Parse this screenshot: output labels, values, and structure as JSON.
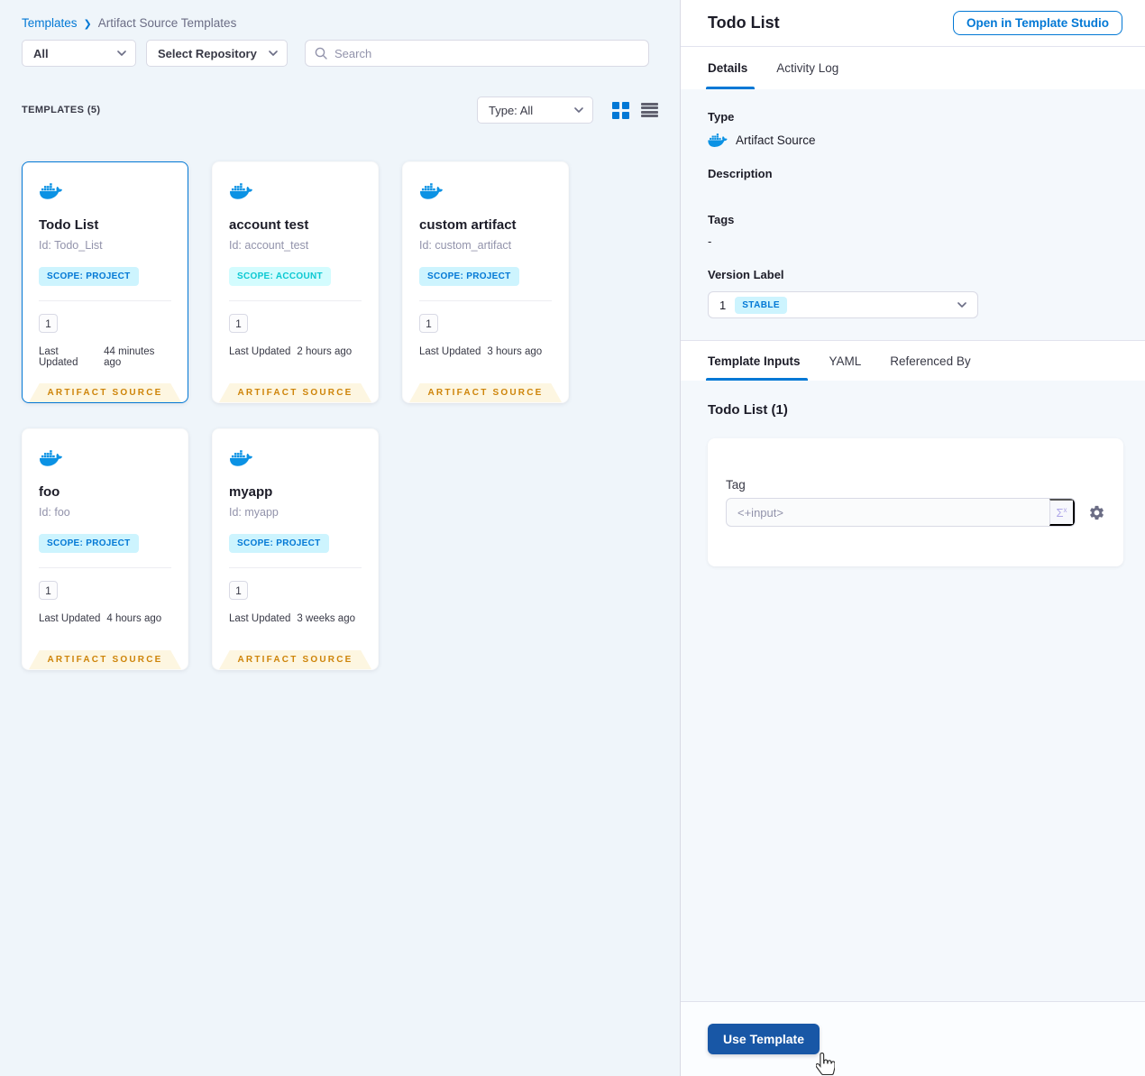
{
  "breadcrumb": {
    "root": "Templates",
    "separator": "❯",
    "current": "Artifact Source Templates"
  },
  "filters": {
    "scope_dropdown": "All",
    "repository_dropdown": "Select Repository",
    "search_placeholder": "Search"
  },
  "list_header": {
    "count_label": "TEMPLATES (5)",
    "type_filter_label": "Type: All"
  },
  "card_labels": {
    "last_updated": "Last Updated"
  },
  "cards": [
    {
      "title": "Todo List",
      "id": "Id: Todo_List",
      "scope": "SCOPE: PROJECT",
      "scope_type": "project",
      "version_count": "1",
      "updated": "44 minutes ago",
      "ribbon": "ARTIFACT SOURCE",
      "selected": true
    },
    {
      "title": "account test",
      "id": "Id: account_test",
      "scope": "SCOPE: ACCOUNT",
      "scope_type": "account",
      "version_count": "1",
      "updated": "2 hours ago",
      "ribbon": "ARTIFACT SOURCE",
      "selected": false
    },
    {
      "title": "custom artifact",
      "id": "Id: custom_artifact",
      "scope": "SCOPE: PROJECT",
      "scope_type": "project",
      "version_count": "1",
      "updated": "3 hours ago",
      "ribbon": "ARTIFACT SOURCE",
      "selected": false
    },
    {
      "title": "foo",
      "id": "Id: foo",
      "scope": "SCOPE: PROJECT",
      "scope_type": "project",
      "version_count": "1",
      "updated": "4 hours ago",
      "ribbon": "ARTIFACT SOURCE",
      "selected": false
    },
    {
      "title": "myapp",
      "id": "Id: myapp",
      "scope": "SCOPE: PROJECT",
      "scope_type": "project",
      "version_count": "1",
      "updated": "3 weeks ago",
      "ribbon": "ARTIFACT SOURCE",
      "selected": false
    }
  ],
  "panel": {
    "title": "Todo List",
    "open_in_studio_button": "Open in Template Studio",
    "tabs": {
      "details": "Details",
      "activity_log": "Activity Log"
    },
    "details": {
      "type_label": "Type",
      "type_value": "Artifact Source",
      "description_label": "Description",
      "tags_label": "Tags",
      "tags_value": "-",
      "version_label": "Version Label",
      "version_value": "1",
      "version_badge": "STABLE"
    },
    "inner_tabs": {
      "template_inputs": "Template Inputs",
      "yaml": "YAML",
      "referenced_by": "Referenced By"
    },
    "inputs": {
      "section_title": "Todo List (1)",
      "tag_label": "Tag",
      "tag_value": "<+input>",
      "expression_button": "Σ"
    },
    "footer": {
      "use_template_button": "Use Template"
    }
  },
  "colors": {
    "accent": "#0278d5",
    "docker_blue": "#0b92e4",
    "scope_project_bg": "#cdf4fe",
    "scope_project_text": "#0278d5",
    "scope_account_bg": "#d3fcfe",
    "scope_account_text": "#0bc8d2",
    "ribbon_bg": "#fdf6e1",
    "ribbon_text": "#ce8409",
    "use_template_bg": "#1857a6"
  }
}
